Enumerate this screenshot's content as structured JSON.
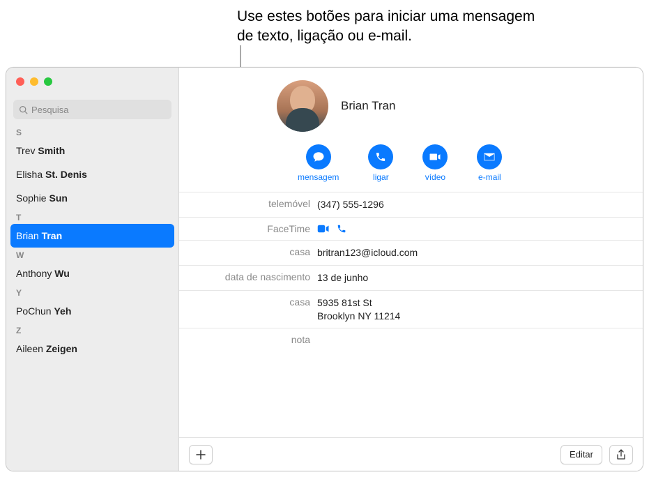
{
  "callout": {
    "text": "Use estes botões para iniciar uma mensagem de texto, ligação ou e-mail."
  },
  "search": {
    "placeholder": "Pesquisa"
  },
  "sidebar": {
    "sections": [
      {
        "letter": "S",
        "contacts": [
          {
            "first": "Trev",
            "last": "Smith"
          },
          {
            "first": "Elisha",
            "last": "St. Denis"
          },
          {
            "first": "Sophie",
            "last": "Sun"
          }
        ]
      },
      {
        "letter": "T",
        "contacts": [
          {
            "first": "Brian",
            "last": "Tran",
            "selected": true
          }
        ]
      },
      {
        "letter": "W",
        "contacts": [
          {
            "first": "Anthony",
            "last": "Wu"
          }
        ]
      },
      {
        "letter": "Y",
        "contacts": [
          {
            "first": "PoChun",
            "last": "Yeh"
          }
        ]
      },
      {
        "letter": "Z",
        "contacts": [
          {
            "first": "Aileen",
            "last": "Zeigen"
          }
        ]
      }
    ]
  },
  "contact": {
    "name": "Brian Tran",
    "actions": {
      "message": "mensagem",
      "call": "ligar",
      "video": "vídeo",
      "email": "e-mail"
    },
    "fields": {
      "mobile_label": "telemóvel",
      "mobile_value": "(347) 555-1296",
      "facetime_label": "FaceTime",
      "home_email_label": "casa",
      "home_email_value": "britran123@icloud.com",
      "birthday_label": "data de nascimento",
      "birthday_value": "13 de junho",
      "home_addr_label": "casa",
      "home_addr_line1": "5935 81st St",
      "home_addr_line2": "Brooklyn NY 11214",
      "note_label": "nota"
    }
  },
  "toolbar": {
    "edit": "Editar"
  }
}
